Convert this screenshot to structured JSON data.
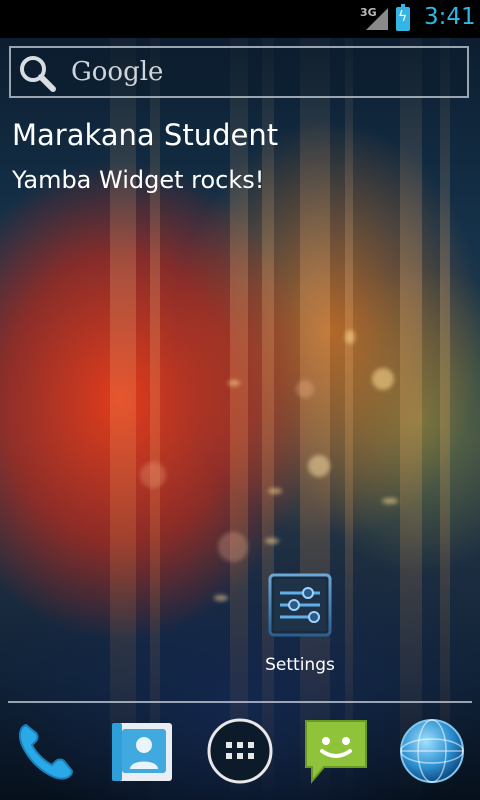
{
  "status_bar": {
    "network": "3G",
    "time": "3:41",
    "icons": [
      "signal-icon",
      "battery-charging-icon"
    ]
  },
  "search_widget": {
    "label": "Google",
    "icon": "search-icon"
  },
  "yamba_widget": {
    "user": "Marakana Student",
    "message": "Yamba Widget rocks!"
  },
  "home_apps": [
    {
      "label": "Settings",
      "icon": "settings-sliders-icon"
    }
  ],
  "dock": [
    {
      "name": "phone",
      "icon": "phone-icon"
    },
    {
      "name": "contacts",
      "icon": "contacts-icon"
    },
    {
      "name": "all-apps",
      "icon": "app-drawer-icon"
    },
    {
      "name": "messaging",
      "icon": "messaging-icon"
    },
    {
      "name": "browser",
      "icon": "globe-icon"
    }
  ],
  "colors": {
    "accent": "#33b5e5",
    "text": "#ffffff"
  }
}
